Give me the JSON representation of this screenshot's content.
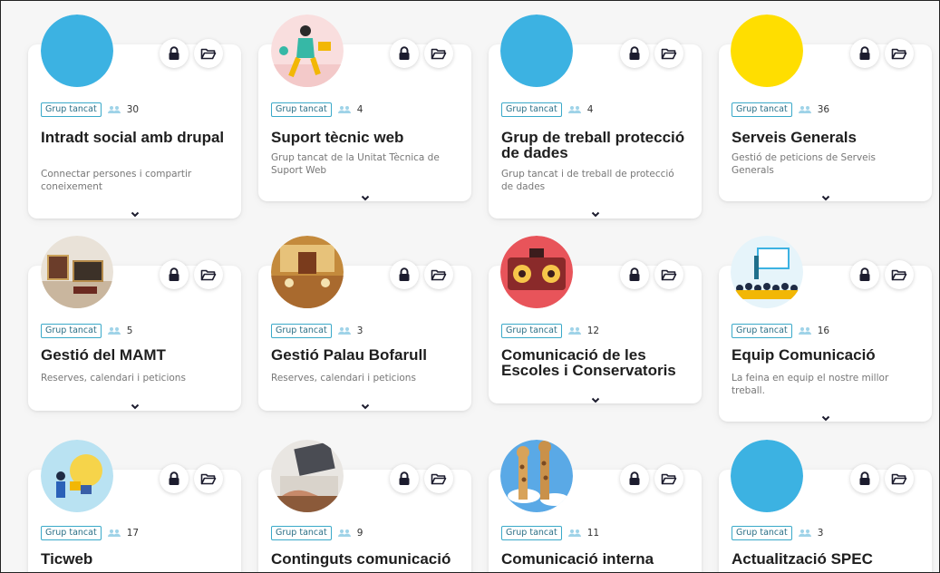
{
  "groups": [
    {
      "badge": "Grup tancat",
      "count": "30",
      "title": "Intradt social amb drupal",
      "desc": "Connectar persones i compartir coneixement",
      "avatar": "solid",
      "color": "#3cb2e2"
    },
    {
      "badge": "Grup tancat",
      "count": "4",
      "title": "Suport tècnic web",
      "desc": "Grup tancat de la Unitat Tècnica de Suport Web",
      "avatar": "illustration-person"
    },
    {
      "badge": "Grup tancat",
      "count": "4",
      "title": "Grup de treball protecció de dades",
      "desc": "Grup tancat i de treball de protecció de dades",
      "avatar": "solid",
      "color": "#3cb2e2"
    },
    {
      "badge": "Grup tancat",
      "count": "36",
      "title": "Serveis Generals",
      "desc": "Gestió de peticions de Serveis Generals",
      "avatar": "solid",
      "color": "#ffde00"
    },
    {
      "badge": "Grup tancat",
      "count": "5",
      "title": "Gestió del MAMT",
      "desc": "Reserves, calendari i peticions",
      "avatar": "photo-museum"
    },
    {
      "badge": "Grup tancat",
      "count": "3",
      "title": "Gestió Palau Bofarull",
      "desc": "Reserves, calendari i peticions",
      "avatar": "photo-palace"
    },
    {
      "badge": "Grup tancat",
      "count": "12",
      "title": "Comunicació de les Escoles i Conservatoris",
      "desc": "",
      "avatar": "photo-radio"
    },
    {
      "badge": "Grup tancat",
      "count": "16",
      "title": "Equip Comunicació",
      "desc": "La feina en equip el nostre millor treball.",
      "avatar": "illustration-team"
    },
    {
      "badge": "Grup tancat",
      "count": "17",
      "title": "Ticweb",
      "desc": "",
      "avatar": "illustration-bulb"
    },
    {
      "badge": "Grup tancat",
      "count": "9",
      "title": "Continguts comunicació",
      "desc": "",
      "avatar": "photo-laptop"
    },
    {
      "badge": "Grup tancat",
      "count": "11",
      "title": "Comunicació interna",
      "desc": "",
      "avatar": "photo-giraffes"
    },
    {
      "badge": "Grup tancat",
      "count": "3",
      "title": "Actualització SPEC",
      "desc": "",
      "avatar": "solid",
      "color": "#3cb2e2"
    }
  ],
  "icons": {
    "lock": "lock-icon",
    "folder": "folder-icon",
    "members": "members-icon",
    "expand": "chevron-down-icon"
  },
  "colors": {
    "badge_border": "#3aa9c9",
    "solid_blue": "#3cb2e2",
    "solid_yellow": "#ffde00"
  }
}
